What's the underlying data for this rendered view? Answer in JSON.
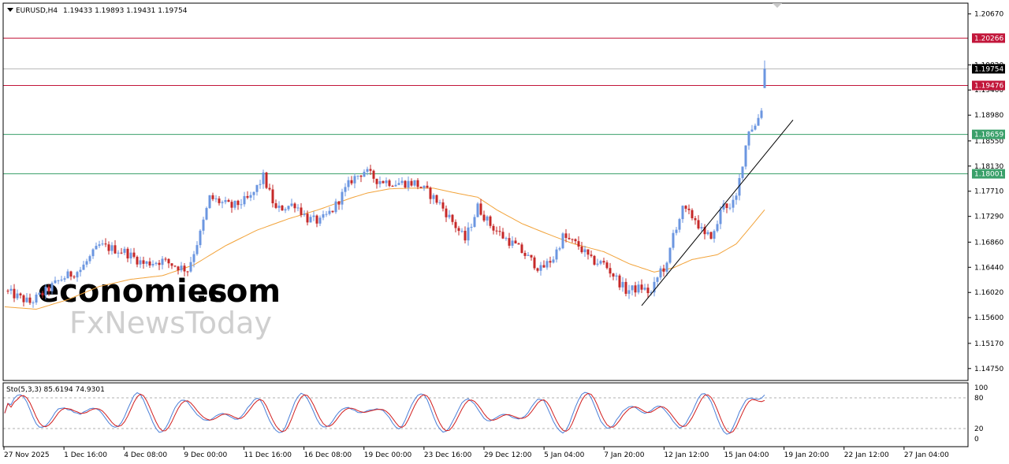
{
  "header": {
    "symbol": "EURUSD,H4",
    "ohlc": "1.19433 1.19893 1.19431 1.19754"
  },
  "watermark": {
    "brand_a": "economies",
    "brand_b": ".com",
    "brand_c": "FxNewsToday"
  },
  "colors": {
    "bull": "#6b96e0",
    "bear": "#c62828",
    "ma": "#f2a33a",
    "resistance": "#c2163a",
    "support": "#3aa06a",
    "current": "#000000",
    "trendline": "#000000",
    "stoch_main": "#4a7fd8",
    "stoch_signal": "#d21e1e"
  },
  "chart_data": {
    "type": "candlestick",
    "price_axis": {
      "range": [
        1.1455,
        1.2085
      ],
      "ticks": [
        "1.20670",
        "1.19820",
        "1.19400",
        "1.18980",
        "1.18550",
        "1.18130",
        "1.17710",
        "1.17290",
        "1.16860",
        "1.16440",
        "1.16020",
        "1.15600",
        "1.15170",
        "1.14750"
      ]
    },
    "time_axis": {
      "labels": [
        "27 Nov 2025",
        "1 Dec 16:00",
        "4 Dec 08:00",
        "9 Dec 00:00",
        "11 Dec 16:00",
        "16 Dec 08:00",
        "19 Dec 00:00",
        "23 Dec 16:00",
        "29 Dec 12:00",
        "5 Jan 04:00",
        "7 Jan 20:00",
        "12 Jan 12:00",
        "15 Jan 04:00",
        "19 Jan 20:00",
        "22 Jan 12:00",
        "27 Jan 04:00"
      ]
    },
    "candle_count": 241,
    "anchors": [
      [
        0,
        1.1605
      ],
      [
        8,
        1.1585
      ],
      [
        12,
        1.16
      ],
      [
        18,
        1.1625
      ],
      [
        24,
        1.164
      ],
      [
        30,
        1.168
      ],
      [
        38,
        1.167
      ],
      [
        44,
        1.165
      ],
      [
        50,
        1.1655
      ],
      [
        55,
        1.1645
      ],
      [
        58,
        1.164
      ],
      [
        62,
        1.17
      ],
      [
        65,
        1.176
      ],
      [
        72,
        1.1745
      ],
      [
        78,
        1.176
      ],
      [
        82,
        1.1795
      ],
      [
        86,
        1.174
      ],
      [
        92,
        1.175
      ],
      [
        96,
        1.1725
      ],
      [
        100,
        1.172
      ],
      [
        104,
        1.174
      ],
      [
        110,
        1.179
      ],
      [
        114,
        1.1805
      ],
      [
        118,
        1.179
      ],
      [
        124,
        1.1785
      ],
      [
        130,
        1.1785
      ],
      [
        134,
        1.177
      ],
      [
        138,
        1.175
      ],
      [
        142,
        1.172
      ],
      [
        146,
        1.169
      ],
      [
        150,
        1.1745
      ],
      [
        154,
        1.1715
      ],
      [
        158,
        1.1695
      ],
      [
        162,
        1.168
      ],
      [
        166,
        1.166
      ],
      [
        170,
        1.164
      ],
      [
        174,
        1.166
      ],
      [
        177,
        1.1695
      ],
      [
        182,
        1.168
      ],
      [
        186,
        1.1655
      ],
      [
        190,
        1.165
      ],
      [
        194,
        1.1625
      ],
      [
        197,
        1.1605
      ],
      [
        202,
        1.161
      ],
      [
        205,
        1.16
      ],
      [
        208,
        1.164
      ],
      [
        210,
        1.1645
      ],
      [
        212,
        1.17
      ],
      [
        215,
        1.174
      ],
      [
        219,
        1.1725
      ],
      [
        222,
        1.1695
      ],
      [
        225,
        1.17
      ],
      [
        228,
        1.1755
      ],
      [
        230,
        1.174
      ],
      [
        232,
        1.176
      ],
      [
        234,
        1.182
      ],
      [
        236,
        1.1875
      ],
      [
        238,
        1.188
      ],
      [
        240,
        1.191
      ],
      [
        241,
        1.19754
      ]
    ],
    "last_candle": {
      "open": 1.19433,
      "high": 1.19893,
      "low": 1.19431,
      "close": 1.19754
    },
    "moving_average_anchors": [
      [
        0,
        1.1578
      ],
      [
        10,
        1.1574
      ],
      [
        20,
        1.159
      ],
      [
        30,
        1.1612
      ],
      [
        40,
        1.1624
      ],
      [
        50,
        1.163
      ],
      [
        60,
        1.1648
      ],
      [
        70,
        1.168
      ],
      [
        80,
        1.1706
      ],
      [
        90,
        1.1725
      ],
      [
        100,
        1.1741
      ],
      [
        110,
        1.176
      ],
      [
        115,
        1.1768
      ],
      [
        122,
        1.1775
      ],
      [
        128,
        1.1776
      ],
      [
        136,
        1.1776
      ],
      [
        144,
        1.1767
      ],
      [
        150,
        1.1761
      ],
      [
        156,
        1.174
      ],
      [
        164,
        1.1717
      ],
      [
        172,
        1.17
      ],
      [
        180,
        1.1684
      ],
      [
        190,
        1.167
      ],
      [
        198,
        1.165
      ],
      [
        206,
        1.1636
      ],
      [
        212,
        1.1643
      ],
      [
        218,
        1.1657
      ],
      [
        226,
        1.1665
      ],
      [
        232,
        1.1683
      ],
      [
        236,
        1.1708
      ],
      [
        241,
        1.174
      ]
    ],
    "levels": [
      {
        "name": "resistance",
        "value": 1.20266,
        "label": "1.20266",
        "color": "#c2163a"
      },
      {
        "name": "current",
        "value": 1.19754,
        "label": "1.19754",
        "color": "#000000"
      },
      {
        "name": "resistance",
        "value": 1.19476,
        "label": "1.19476",
        "color": "#c2163a"
      },
      {
        "name": "support",
        "value": 1.18659,
        "label": "1.18659",
        "color": "#3aa06a"
      },
      {
        "name": "support",
        "value": 1.18001,
        "label": "1.18001",
        "color": "#3aa06a"
      }
    ],
    "trendline": {
      "from": [
        202,
        1.158
      ],
      "to": [
        250,
        1.189
      ]
    },
    "stochastic": {
      "label": "Sto(5,3,3) 85.6194 74.9301",
      "main": 85.6194,
      "signal": 74.9301,
      "range": [
        0,
        100
      ],
      "ticks": [
        "100",
        "80",
        "20",
        "0"
      ],
      "levels": [
        80,
        20
      ]
    }
  }
}
